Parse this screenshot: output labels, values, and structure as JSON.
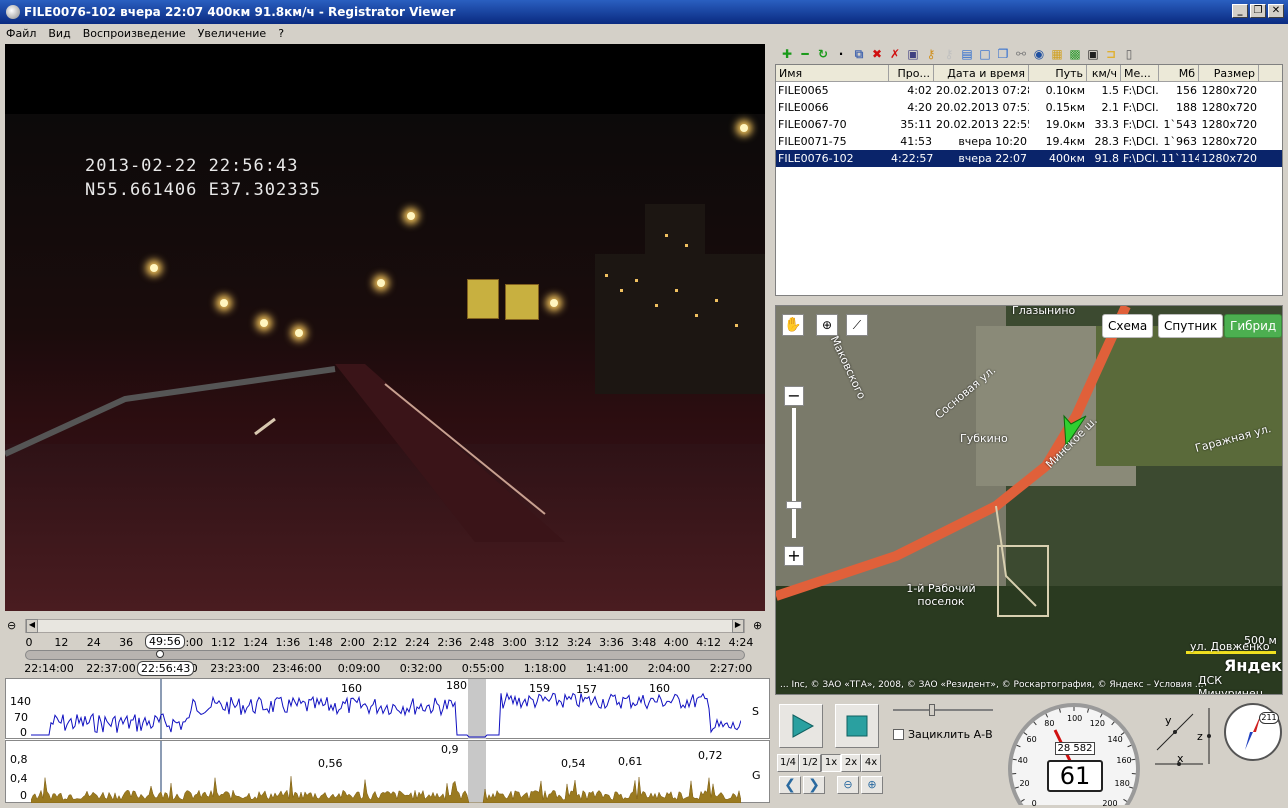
{
  "window": {
    "title": "FILE0076-102    вчера 22:07    400км    91.8км/ч - Registrator Viewer",
    "min": "_",
    "max": "❐",
    "close": "✕"
  },
  "menu": [
    "Файл",
    "Вид",
    "Воспроизведение",
    "Увеличение",
    "?"
  ],
  "video": {
    "osd_time": "2013-02-22  22:56:43",
    "osd_coords": "N55.661406  E37.302335"
  },
  "timeline": {
    "ticks": [
      "0",
      "12",
      "24",
      "36",
      "48",
      "1:00",
      "1:12",
      "1:24",
      "1:36",
      "1:48",
      "2:00",
      "2:12",
      "2:24",
      "2:36",
      "2:48",
      "3:00",
      "3:12",
      "3:24",
      "3:36",
      "3:48",
      "4:00",
      "4:12",
      "4:24"
    ],
    "cursor_label": "49:56",
    "times": [
      "22:14:00",
      "22:37:00",
      "23:00:00",
      "23:23:00",
      "23:46:00",
      "0:09:00",
      "0:32:00",
      "0:55:00",
      "1:18:00",
      "1:41:00",
      "2:04:00",
      "2:27:00"
    ],
    "time_badge": "22:56:43"
  },
  "speed_graph": {
    "y_ticks": [
      "140",
      "70",
      "0"
    ],
    "label": "S",
    "peaks": [
      "160",
      "180",
      "159",
      "157",
      "160"
    ]
  },
  "g_graph": {
    "y_ticks": [
      "0,8",
      "0,4",
      "0"
    ],
    "label": "G",
    "peaks": [
      "0,56",
      "0,9",
      "0,54",
      "0,61",
      "0,72"
    ]
  },
  "files": {
    "columns": [
      "Имя",
      "Про...",
      "Дата и время",
      "Путь",
      "км/ч",
      "Ме...",
      "Мб",
      "Размер"
    ],
    "rows": [
      [
        "FILE0065",
        "4:02",
        "20.02.2013 07:28",
        "0.10км",
        "1.5",
        "F:\\DCI...",
        "156",
        "1280x720"
      ],
      [
        "FILE0066",
        "4:20",
        "20.02.2013 07:53",
        "0.15км",
        "2.1",
        "F:\\DCI...",
        "188",
        "1280x720"
      ],
      [
        "FILE0067-70",
        "35:11",
        "20.02.2013 22:55",
        "19.0км",
        "33.3",
        "F:\\DCI...",
        "1`543",
        "1280x720"
      ],
      [
        "FILE0071-75",
        "41:53",
        "вчера 10:20",
        "19.4км",
        "28.3",
        "F:\\DCI...",
        "1`963",
        "1280x720"
      ],
      [
        "FILE0076-102",
        "4:22:57",
        "вчера 22:07",
        "400км",
        "91.8",
        "F:\\DCI...",
        "11`114",
        "1280x720"
      ]
    ],
    "selected": 4
  },
  "map": {
    "buttons": [
      "Схема",
      "Спутник",
      "Гибрид"
    ],
    "labels": [
      "Глазынино",
      "Сосновая ул.",
      "Губкино",
      "Минское ш.",
      "Гаражная ул.",
      "1-й Рабочий поселок",
      "Маковского",
      "ул. Довженко",
      "ДСК Мичуринец"
    ],
    "scale": "500 м",
    "brand": "Яндекс",
    "copyright": "... Inc, © ЗАО «ТГА», 2008, © ЗАО «Резидент», © Роскартография, © Яндекс – Условия ..."
  },
  "player": {
    "loop_label": "Зациклить А-В",
    "speeds": [
      "1/4",
      "1/2",
      "1x",
      "2x",
      "4x"
    ]
  },
  "speedo": {
    "odometer": "28 582",
    "speed": "61",
    "scale": [
      "0",
      "20",
      "40",
      "60",
      "80",
      "100",
      "120",
      "140",
      "160",
      "180",
      "200"
    ]
  },
  "compass": {
    "heading": "211"
  },
  "axes": {
    "x": "x",
    "y": "y",
    "z": "z"
  }
}
